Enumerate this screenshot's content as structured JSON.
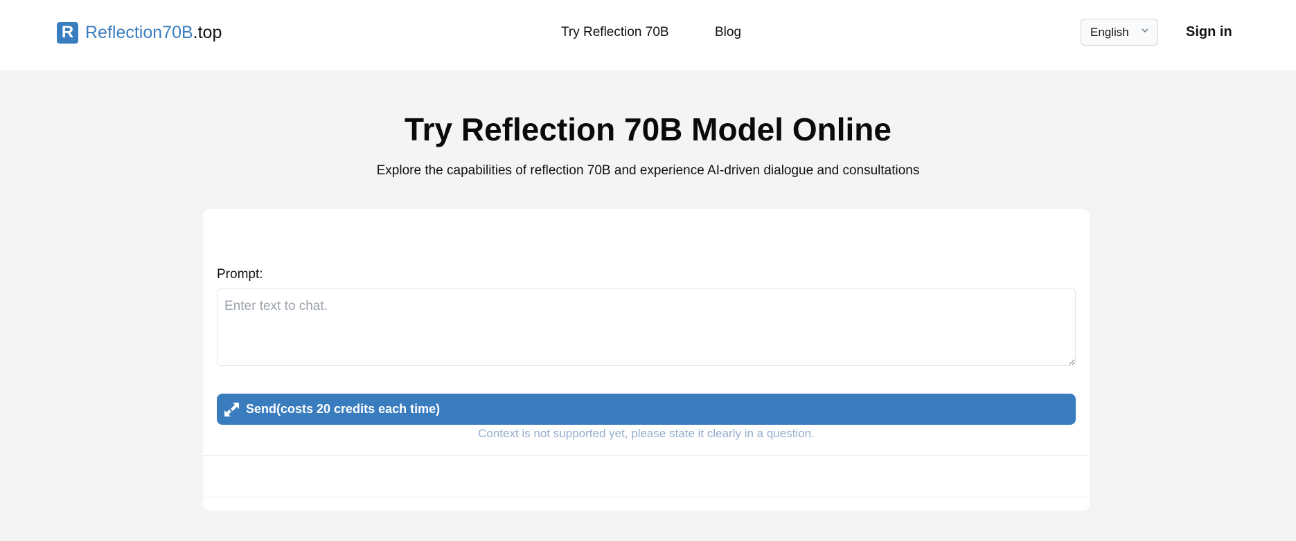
{
  "header": {
    "logo_mark": "R",
    "logo_brand": "Reflection70B",
    "logo_suffix": ".top",
    "nav": [
      {
        "label": "Try Reflection 70B"
      },
      {
        "label": "Blog"
      }
    ],
    "language": "English",
    "signin_label": "Sign in"
  },
  "main": {
    "title": "Try Reflection 70B Model Online",
    "subtitle": "Explore the capabilities of reflection 70B and experience AI-driven dialogue and consultations"
  },
  "chat": {
    "prompt_label": "Prompt:",
    "prompt_value": "",
    "prompt_placeholder": "Enter text to chat.",
    "send_label": "Send(costs 20 credits each time)",
    "note": "Context is not supported yet, please state it clearly in a question."
  },
  "colors": {
    "accent": "#3a7dbf",
    "page_bg": "#f3f4f6",
    "note_text": "#94aecd"
  },
  "icons": {
    "language_chevron": "chevron-down-icon",
    "send": "send-arrows-icon"
  }
}
